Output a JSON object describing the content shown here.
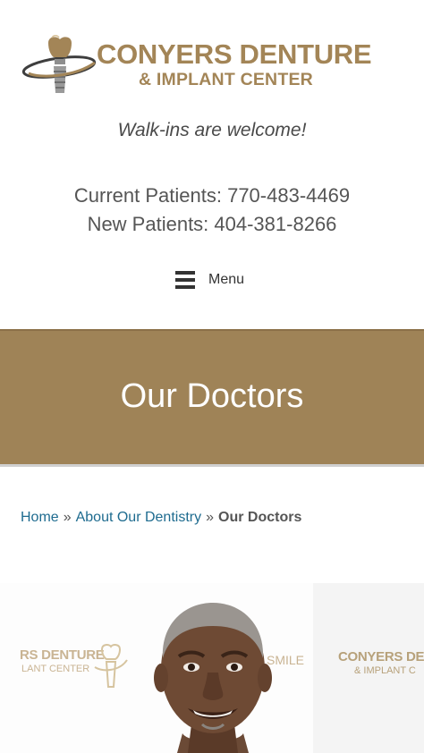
{
  "logo": {
    "line1": "CONYERS DENTURE",
    "line2": "& IMPLANT CENTER",
    "icon": "tooth-implant-icon"
  },
  "header": {
    "tagline": "Walk-ins are welcome!",
    "phone_current": "Current Patients: 770-483-4469",
    "phone_new": "New Patients: 404-381-8266"
  },
  "nav": {
    "menu_label": "Menu",
    "menu_icon": "hamburger-icon"
  },
  "banner": {
    "title": "Our Doctors"
  },
  "breadcrumb": {
    "items": [
      "Home",
      "About Our Dentistry"
    ],
    "separator": "»",
    "current": "Our Doctors"
  },
  "photo": {
    "backdrop_text_left_1": "RS DENTURE",
    "backdrop_text_left_2": "LANT CENTER",
    "backdrop_text_mid": "SMILE",
    "backdrop_text_right_1": "CONYERS DE",
    "backdrop_text_right_2": "& IMPLANT C"
  },
  "colors": {
    "brand_gold": "#a38557",
    "banner_bg": "#9f8357",
    "link": "#1e6b8f"
  }
}
